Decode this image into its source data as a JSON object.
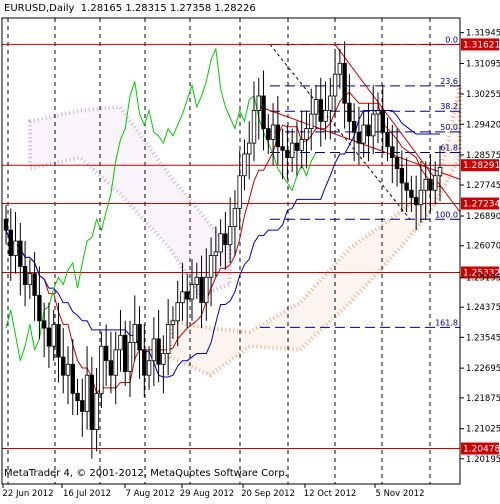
{
  "header": {
    "symbol": "EURUSD,Daily",
    "ohlc": "1.28165 1.28315 1.27358 1.28226"
  },
  "footer": {
    "watermark": "MetaTrader 4, © 2001-2012, MetaQuotes Software Corp."
  },
  "chart_data": {
    "type": "candlestick",
    "title": "EURUSD,Daily",
    "ylim": [
      1.195,
      1.3235
    ],
    "y_ticks": [
      "1.31945",
      "1.31095",
      "1.30255",
      "1.29420",
      "1.28575",
      "1.27745",
      "1.26890",
      "1.26070",
      "1.25195",
      "1.24375",
      "1.23545",
      "1.22695",
      "1.21875",
      "1.21025",
      "1.20195"
    ],
    "x_ticks": [
      "22 Jun 2012",
      "16 Jul 2012",
      "7 Aug 2012",
      "29 Aug 2012",
      "20 Sep 2012",
      "12 Oct 2012",
      "5 Nov 2012"
    ],
    "highlighted_levels": [
      {
        "value": 1.31621,
        "label": "1.31621"
      },
      {
        "value": 1.28291,
        "label": "1.28291"
      },
      {
        "value": 1.27234,
        "label": "1.27234"
      },
      {
        "value": 1.25332,
        "label": "1.25332"
      },
      {
        "value": 1.20478,
        "label": "1.20478"
      }
    ],
    "fibonacci": {
      "high": 1.3162,
      "low": 1.268,
      "levels": [
        {
          "label": "0.0",
          "value": 1.3162
        },
        {
          "label": "23.6",
          "value": 1.3048
        },
        {
          "label": "38.2",
          "value": 1.2978
        },
        {
          "label": "50.0",
          "value": 1.2921
        },
        {
          "label": "61.8",
          "value": 1.2864
        },
        {
          "label": "100.0",
          "value": 1.268
        },
        {
          "label": "161.8",
          "value": 1.2382
        }
      ]
    },
    "colors": {
      "candles": "#000000",
      "tenkan": "#cc0000",
      "kijun": "#0000cc",
      "chikou": "#00cc00",
      "cloud_a": "#e8a77a",
      "cloud_b": "#c8a8d8",
      "level_line": "#cc0000",
      "level_label_bg": "#cc0000",
      "fib_line": "#000080",
      "trend_line": "#cc0000"
    },
    "close_series": [
      1.265,
      1.258,
      1.262,
      1.255,
      1.25,
      1.253,
      1.247,
      1.24,
      1.238,
      1.233,
      1.239,
      1.23,
      1.225,
      1.228,
      1.22,
      1.218,
      1.215,
      1.225,
      1.21,
      1.22,
      1.233,
      1.229,
      1.225,
      1.232,
      1.236,
      1.226,
      1.234,
      1.239,
      1.232,
      1.225,
      1.229,
      1.235,
      1.228,
      1.231,
      1.239,
      1.24,
      1.245,
      1.248,
      1.246,
      1.25,
      1.252,
      1.245,
      1.252,
      1.258,
      1.259,
      1.264,
      1.261,
      1.266,
      1.271,
      1.28,
      1.286,
      1.289,
      1.298,
      1.302,
      1.293,
      1.29,
      1.294,
      1.288,
      1.287,
      1.285,
      1.289,
      1.287,
      1.29,
      1.293,
      1.297,
      1.301,
      1.295,
      1.298,
      1.302,
      1.308,
      1.311,
      1.3,
      1.295,
      1.292,
      1.289,
      1.294,
      1.291,
      1.297,
      1.298,
      1.292,
      1.288,
      1.285,
      1.282,
      1.278,
      1.276,
      1.274,
      1.272,
      1.276,
      1.279,
      1.276,
      1.28,
      1.2823
    ]
  }
}
